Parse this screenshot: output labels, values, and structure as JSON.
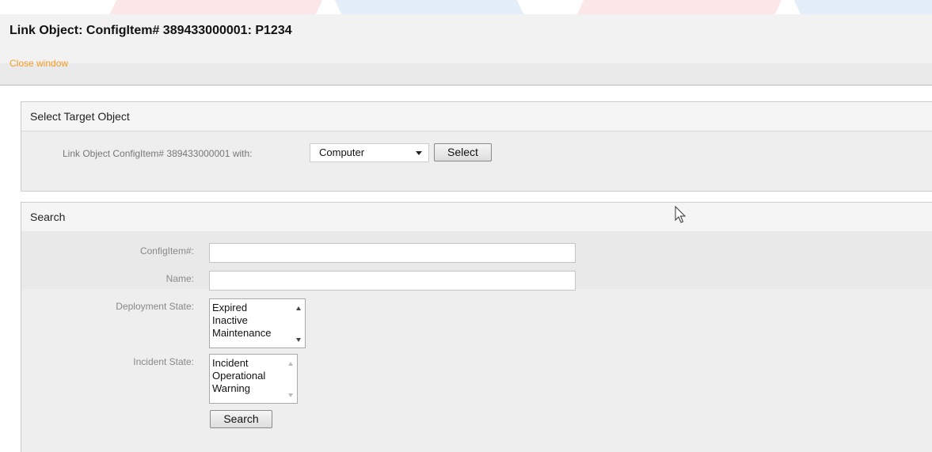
{
  "header": {
    "title": "Link Object: ConfigItem# 389433000001: P1234",
    "close_label": "Close window",
    "link_color": "#f59a23"
  },
  "target": {
    "title": "Select Target Object",
    "label": "Link Object ConfigItem# 389433000001 with:",
    "selected_object": "Computer",
    "select_button": "Select"
  },
  "search": {
    "title": "Search",
    "fields": {
      "configitem_label": "ConfigItem#:",
      "configitem_value": "",
      "name_label": "Name:",
      "name_value": "",
      "deployment_label": "Deployment State:",
      "deployment_options": [
        "Expired",
        "Inactive",
        "Maintenance"
      ],
      "incident_label": "Incident State:",
      "incident_options": [
        "Incident",
        "Operational",
        "Warning"
      ]
    },
    "search_button": "Search"
  }
}
